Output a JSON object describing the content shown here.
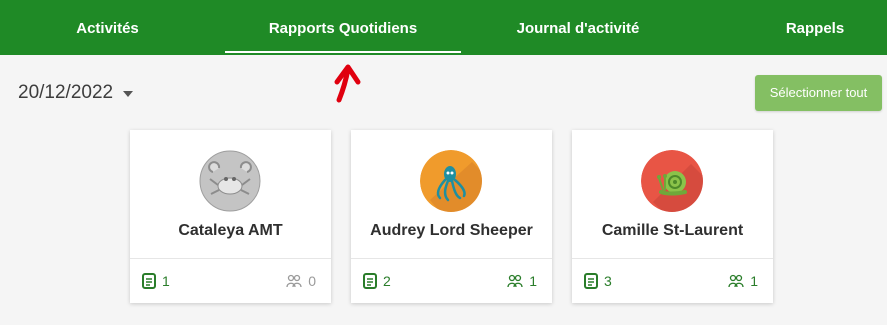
{
  "nav": {
    "tabs": [
      {
        "label": "Activités"
      },
      {
        "label": "Rapports Quotidiens",
        "active": true
      },
      {
        "label": "Journal d'activité"
      },
      {
        "label": "Rappels"
      }
    ]
  },
  "date_selector": {
    "value": "20/12/2022"
  },
  "select_all_label": "Sélectionner tout",
  "colors": {
    "header_green": "#1f8a26",
    "button_green": "#84bf63",
    "stat_green": "#2a7d2a",
    "annotation_red": "#e0000f"
  },
  "children": [
    {
      "name": "Cataleya AMT",
      "avatar": "crab-icon",
      "reports": "1",
      "people": "0",
      "people_active": false
    },
    {
      "name": "Audrey Lord Sheeper",
      "avatar": "octopus-icon",
      "reports": "2",
      "people": "1",
      "people_active": true
    },
    {
      "name": "Camille St-Laurent",
      "avatar": "snail-icon",
      "reports": "3",
      "people": "1",
      "people_active": true
    }
  ]
}
